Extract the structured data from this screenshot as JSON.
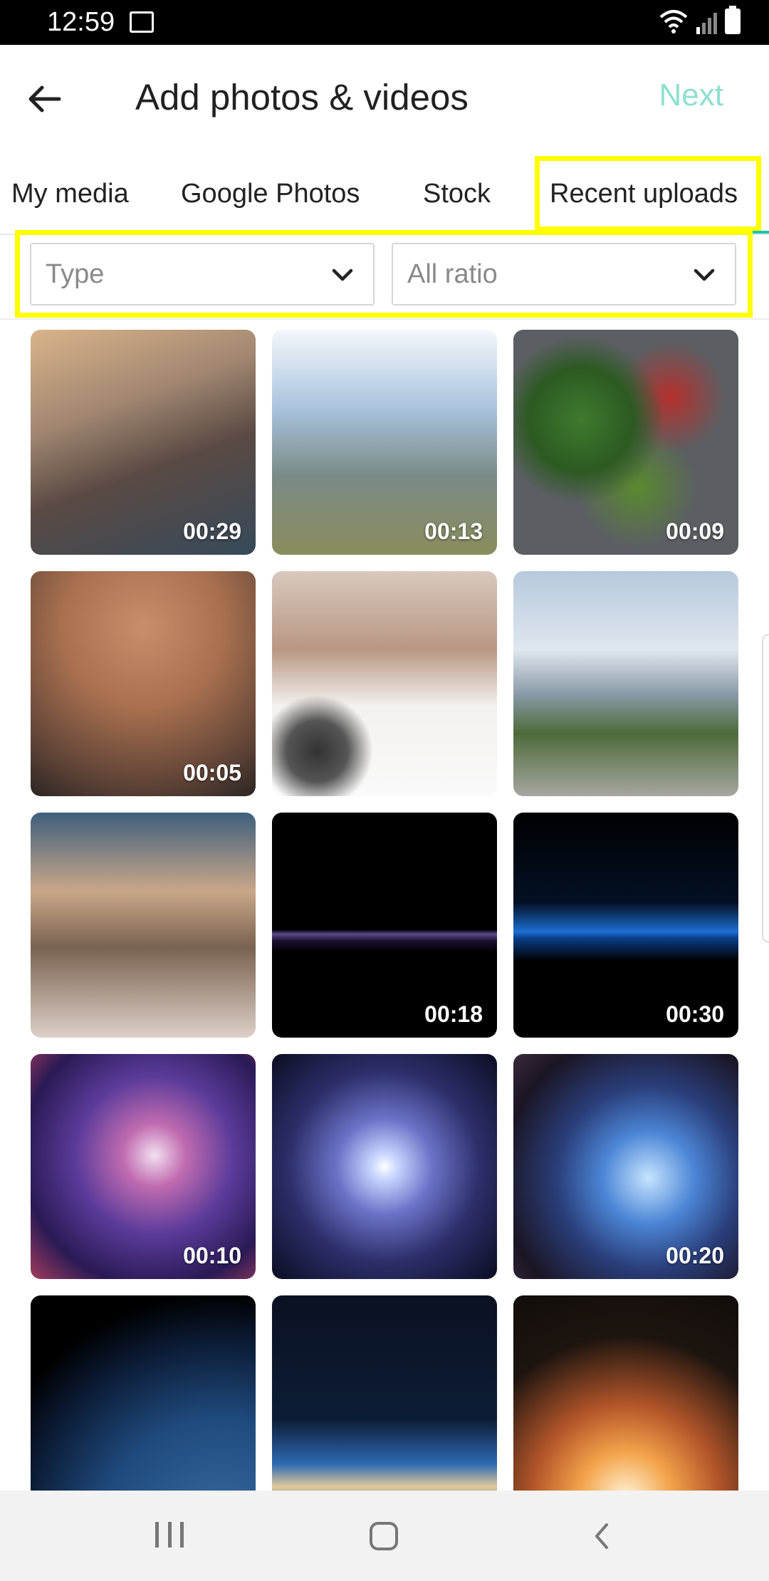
{
  "status": {
    "time": "12:59"
  },
  "header": {
    "title": "Add photos & videos",
    "next": "Next"
  },
  "tabs": [
    "My media",
    "Google Photos",
    "Stock",
    "Recent uploads"
  ],
  "filters": {
    "type": "Type",
    "ratio": "All ratio"
  },
  "media": [
    {
      "duration": "00:29"
    },
    {
      "duration": "00:13"
    },
    {
      "duration": "00:09"
    },
    {
      "duration": "00:05"
    },
    {
      "duration": ""
    },
    {
      "duration": ""
    },
    {
      "duration": ""
    },
    {
      "duration": "00:18"
    },
    {
      "duration": "00:30"
    },
    {
      "duration": "00:10"
    },
    {
      "duration": ""
    },
    {
      "duration": "00:20"
    },
    {
      "duration": ""
    },
    {
      "duration": ""
    },
    {
      "duration": ""
    }
  ],
  "colors": {
    "accent": "#19c7a7",
    "next_disabled": "#8de0cf",
    "highlight": "#ffff00"
  }
}
